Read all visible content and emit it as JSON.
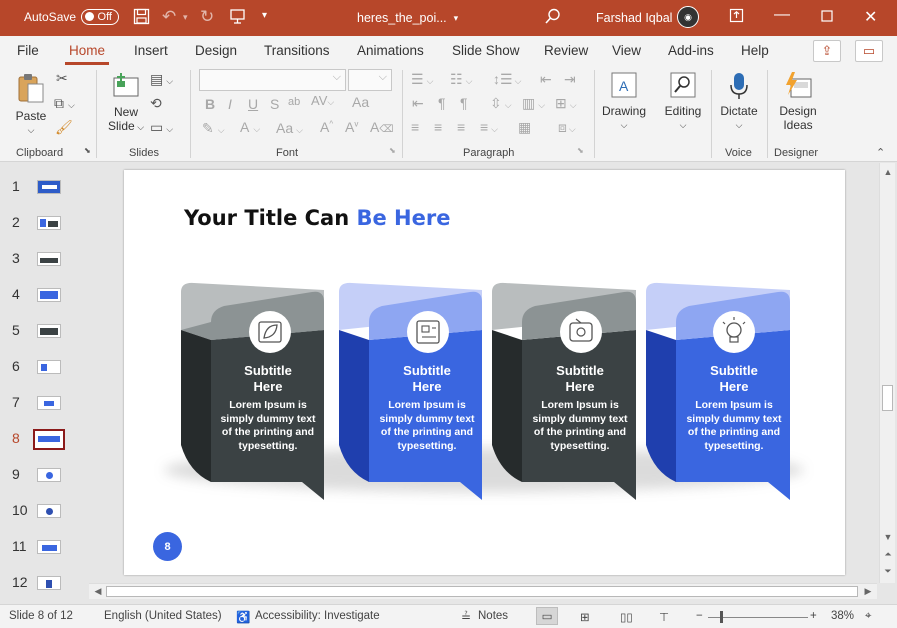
{
  "titlebar": {
    "autosave_label": "AutoSave",
    "autosave_state": "Off",
    "filename": "heres_the_poi...",
    "user": "Farshad Iqbal"
  },
  "tabs": [
    "File",
    "Home",
    "Insert",
    "Design",
    "Transitions",
    "Animations",
    "Slide Show",
    "Review",
    "View",
    "Add-ins",
    "Help"
  ],
  "active_tab": "Home",
  "ribbon": {
    "paste": "Paste",
    "new_slide_line1": "New",
    "new_slide_line2": "Slide",
    "drawing": "Drawing",
    "editing": "Editing",
    "dictate": "Dictate",
    "design_ideas_line1": "Design",
    "design_ideas_line2": "Ideas",
    "groups": [
      "Clipboard",
      "Slides",
      "Font",
      "Paragraph",
      "Voice",
      "Designer"
    ]
  },
  "thumbnails": {
    "numbers": [
      "1",
      "2",
      "3",
      "4",
      "5",
      "6",
      "7",
      "8",
      "9",
      "10",
      "11",
      "12"
    ],
    "active": 8
  },
  "slide": {
    "title_main": "Your Title Can ",
    "title_accent": "Be Here",
    "page_number": "8",
    "cards": [
      {
        "subtitle1": "Subtitle",
        "subtitle2": "Here",
        "body": [
          "Lorem Ipsum is",
          "simply dummy text",
          "of the printing and",
          "typesetting."
        ],
        "theme": "dark",
        "icon": "leaf-icon"
      },
      {
        "subtitle1": "Subtitle",
        "subtitle2": "Here",
        "body": [
          "Lorem Ipsum is",
          "simply dummy text",
          "of the printing and",
          "typesetting."
        ],
        "theme": "blue",
        "icon": "circuit-board-icon"
      },
      {
        "subtitle1": "Subtitle",
        "subtitle2": "Here",
        "body": [
          "Lorem Ipsum is",
          "simply dummy text",
          "of the printing and",
          "typesetting."
        ],
        "theme": "dark",
        "icon": "tablet-icon"
      },
      {
        "subtitle1": "Subtitle",
        "subtitle2": "Here",
        "body": [
          "Lorem Ipsum is",
          "simply dummy text",
          "of the printing and",
          "typesetting."
        ],
        "theme": "blue",
        "icon": "lightbulb-icon"
      }
    ]
  },
  "status": {
    "slide_count": "Slide 8 of 12",
    "language": "English (United States)",
    "accessibility": "Accessibility: Investigate",
    "notes": "Notes",
    "zoom": "38%"
  },
  "colors": {
    "brand": "#b7472a",
    "accent": "#3a66e0",
    "dark_card": "#3b4244",
    "blue_card": "#3a66e0"
  }
}
